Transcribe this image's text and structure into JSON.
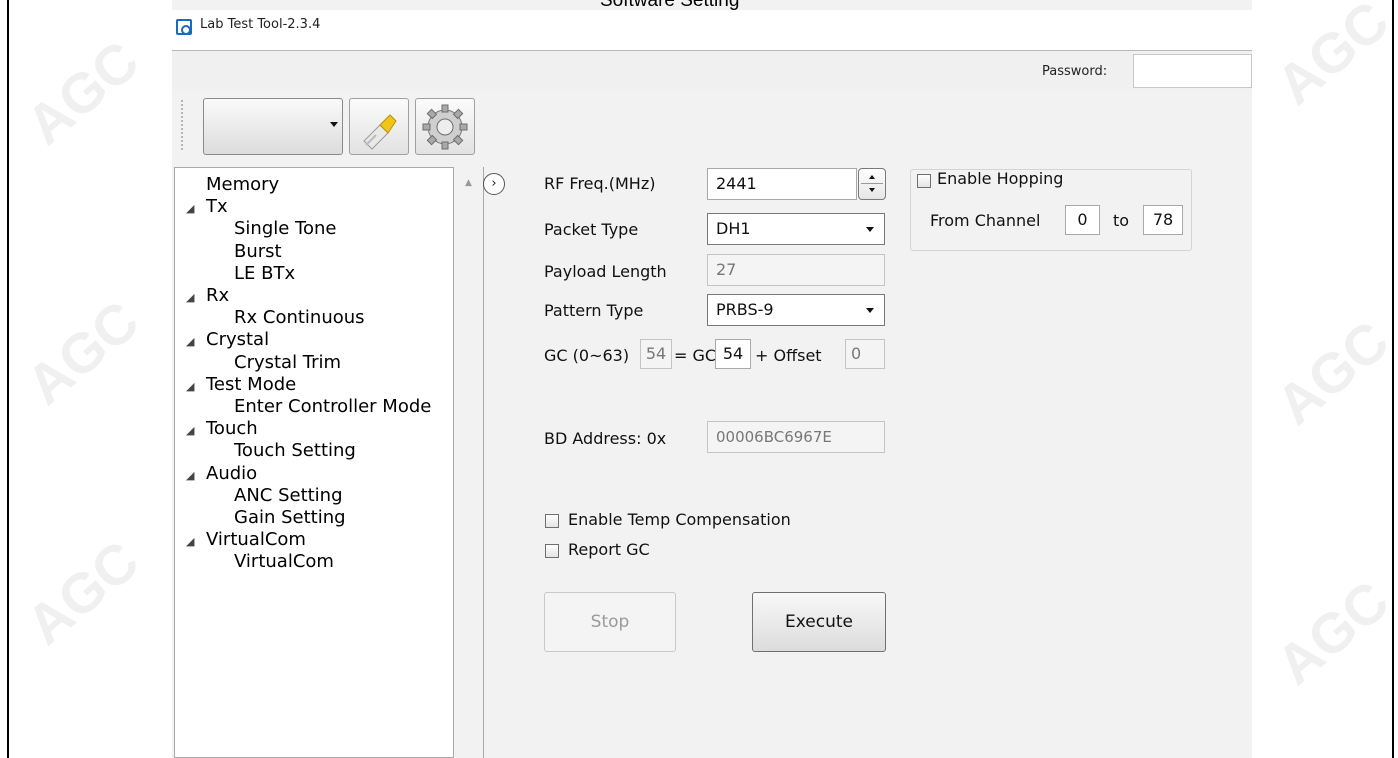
{
  "caption": "Software Setting",
  "window": {
    "title": "Lab Test Tool-2.3.4",
    "password_label": "Password:",
    "password_value": ""
  },
  "toolbar": {
    "combo_value": "",
    "icons": [
      "brush-icon",
      "gear-icon"
    ]
  },
  "tree": {
    "items": [
      {
        "label": "Memory",
        "level": 0,
        "expandable": false
      },
      {
        "label": "Tx",
        "level": 0,
        "expandable": true
      },
      {
        "label": "Single Tone",
        "level": 1
      },
      {
        "label": "Burst",
        "level": 1
      },
      {
        "label": "LE BTx",
        "level": 1
      },
      {
        "label": "Rx",
        "level": 0,
        "expandable": true
      },
      {
        "label": "Rx Continuous",
        "level": 1
      },
      {
        "label": "Crystal",
        "level": 0,
        "expandable": true
      },
      {
        "label": "Crystal Trim",
        "level": 1
      },
      {
        "label": "Test Mode",
        "level": 0,
        "expandable": true
      },
      {
        "label": "Enter Controller Mode",
        "level": 1
      },
      {
        "label": "Touch",
        "level": 0,
        "expandable": true
      },
      {
        "label": "Touch Setting",
        "level": 1
      },
      {
        "label": "Audio",
        "level": 0,
        "expandable": true
      },
      {
        "label": "ANC Setting",
        "level": 1
      },
      {
        "label": "Gain Setting",
        "level": 1
      },
      {
        "label": "VirtualCom",
        "level": 0,
        "expandable": true
      },
      {
        "label": "VirtualCom",
        "level": 1
      }
    ]
  },
  "form": {
    "rf_freq_label": "RF Freq.(MHz)",
    "rf_freq_value": "2441",
    "packet_type_label": "Packet Type",
    "packet_type_value": "DH1",
    "payload_length_label": "Payload Length",
    "payload_length_value": "27",
    "pattern_type_label": "Pattern Type",
    "pattern_type_value": "PRBS-9",
    "gc_label": "GC (0~63)",
    "gc_total": "54",
    "gc_eq": "= GC",
    "gc_value": "54",
    "offset_label": "+ Offset",
    "offset_value": "0",
    "bd_address_label": "BD Address: 0x",
    "bd_address_value": "00006BC6967E",
    "enable_temp_label": "Enable Temp Compensation",
    "report_gc_label": "Report GC"
  },
  "hopping": {
    "enable_label": "Enable Hopping",
    "from_label": "From Channel",
    "from_value": "0",
    "to_label": "to",
    "to_value": "78"
  },
  "buttons": {
    "stop": "Stop",
    "execute": "Execute"
  }
}
